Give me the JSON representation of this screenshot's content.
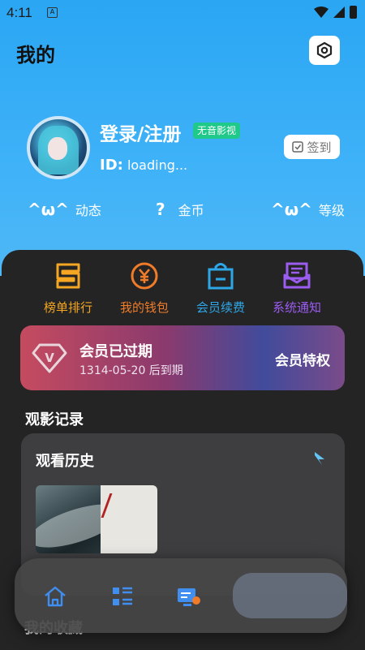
{
  "status_bar": {
    "time": "4:11",
    "app_glyph": "A"
  },
  "header": {
    "title": "我的"
  },
  "profile": {
    "login_label": "登录/注册",
    "app_tag": "无音影视",
    "id_label": "ID:",
    "id_value": "loading...",
    "checkin_label": "签到"
  },
  "stats": [
    {
      "value": "^ω^",
      "label": "动态"
    },
    {
      "value": "?",
      "label": "金币"
    },
    {
      "value": "^ω^",
      "label": "等级"
    }
  ],
  "quick_actions": [
    {
      "label": "榜单排行",
      "icon": "ranking-icon",
      "color": "#f5a623"
    },
    {
      "label": "我的钱包",
      "icon": "wallet-icon",
      "color": "#f07c2a"
    },
    {
      "label": "会员续费",
      "icon": "shopping-bag-icon",
      "color": "#2ea7e8"
    },
    {
      "label": "系统通知",
      "icon": "mail-icon",
      "color": "#9b5cf0"
    }
  ],
  "vip": {
    "status": "会员已过期",
    "expire_text": "1314-05-20 后到期",
    "privilege_label": "会员特权",
    "badge_letter": "V"
  },
  "history": {
    "section_title": "观影记录",
    "card_title": "观看历史"
  },
  "partial_label": "我的收藏",
  "tabbar": [
    "home-icon",
    "category-icon",
    "tv-icon",
    "profile-icon"
  ],
  "colors": {
    "hero": "#2aa6f3",
    "tag": "#1ec98a",
    "sheet": "#242424"
  }
}
